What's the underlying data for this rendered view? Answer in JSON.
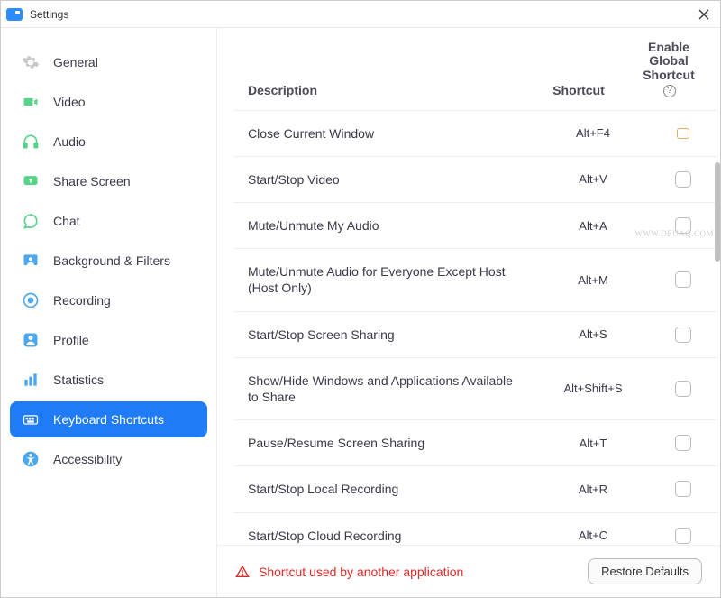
{
  "window": {
    "title": "Settings"
  },
  "sidebar": {
    "items": [
      {
        "id": "general",
        "label": "General",
        "active": false
      },
      {
        "id": "video",
        "label": "Video",
        "active": false
      },
      {
        "id": "audio",
        "label": "Audio",
        "active": false
      },
      {
        "id": "share-screen",
        "label": "Share Screen",
        "active": false
      },
      {
        "id": "chat",
        "label": "Chat",
        "active": false
      },
      {
        "id": "background-filters",
        "label": "Background & Filters",
        "active": false
      },
      {
        "id": "recording",
        "label": "Recording",
        "active": false
      },
      {
        "id": "profile",
        "label": "Profile",
        "active": false
      },
      {
        "id": "statistics",
        "label": "Statistics",
        "active": false
      },
      {
        "id": "keyboard-shortcuts",
        "label": "Keyboard Shortcuts",
        "active": true
      },
      {
        "id": "accessibility",
        "label": "Accessibility",
        "active": false
      }
    ]
  },
  "table": {
    "headers": {
      "description": "Description",
      "shortcut": "Shortcut",
      "enable_global": "Enable Global Shortcut"
    },
    "rows": [
      {
        "desc": "Close Current Window",
        "shortcut": "Alt+F4",
        "checked": false,
        "small": true
      },
      {
        "desc": "Start/Stop Video",
        "shortcut": "Alt+V",
        "checked": false
      },
      {
        "desc": "Mute/Unmute My Audio",
        "shortcut": "Alt+A",
        "checked": false
      },
      {
        "desc": "Mute/Unmute Audio for Everyone Except Host (Host Only)",
        "shortcut": "Alt+M",
        "checked": false
      },
      {
        "desc": "Start/Stop Screen Sharing",
        "shortcut": "Alt+S",
        "checked": false
      },
      {
        "desc": "Show/Hide Windows and Applications Available to Share",
        "shortcut": "Alt+Shift+S",
        "checked": false
      },
      {
        "desc": "Pause/Resume Screen Sharing",
        "shortcut": "Alt+T",
        "checked": false
      },
      {
        "desc": "Start/Stop Local Recording",
        "shortcut": "Alt+R",
        "checked": false
      },
      {
        "desc": "Start/Stop Cloud Recording",
        "shortcut": "Alt+C",
        "checked": false
      }
    ]
  },
  "footer": {
    "warning": "Shortcut used by another application",
    "restore": "Restore Defaults"
  },
  "watermark": "WWW.DEUAQ.COM"
}
